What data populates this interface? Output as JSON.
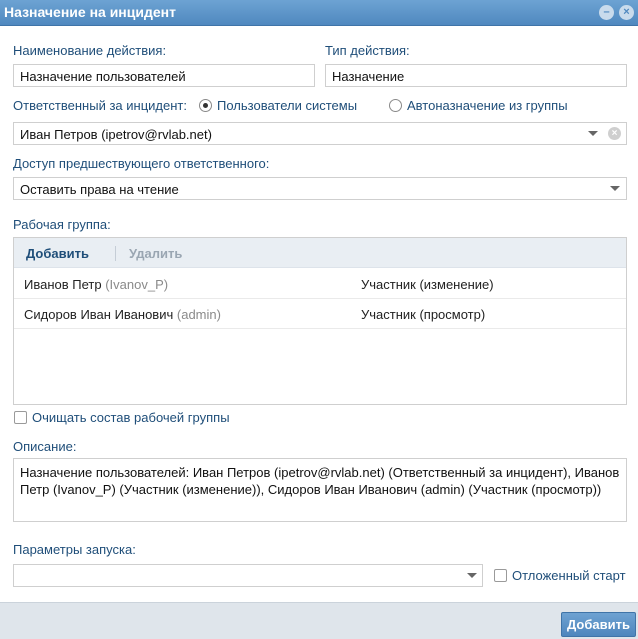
{
  "window": {
    "title": "Назначение на инцидент",
    "minimize_icon": "minimize-icon",
    "close_icon": "close-icon"
  },
  "form": {
    "action_name_label": "Наименование действия:",
    "action_name_value": "Назначение пользователей",
    "action_type_label": "Тип действия:",
    "action_type_value": "Назначение",
    "responsible_label": "Ответственный за инцидент:",
    "radio_system_users": "Пользователи системы",
    "radio_auto_assign": "Автоназначение из группы",
    "responsible_value": "Иван Петров (ipetrov@rvlab.net)",
    "prev_access_label": "Доступ предшествующего ответственного:",
    "prev_access_value": "Оставить права на чтение",
    "workgroup_label": "Рабочая группа:",
    "clear_workgroup_label": "Очищать состав рабочей группы",
    "description_label": "Описание:",
    "description_value": "Назначение пользователей: Иван Петров (ipetrov@rvlab.net) (Ответственный за инцидент), Иванов Петр (Ivanov_P) (Участник (изменение)), Сидоров Иван Иванович (admin) (Участник (просмотр))",
    "launch_params_label": "Параметры запуска:",
    "launch_params_value": "",
    "deferred_start_label": "Отложенный старт"
  },
  "workgroup": {
    "add_label": "Добавить",
    "delete_label": "Удалить",
    "rows": [
      {
        "name": "Иванов Петр",
        "login": "(Ivanov_P)",
        "role": "Участник (изменение)"
      },
      {
        "name": "Сидоров Иван Иванович",
        "login": "(admin)",
        "role": "Участник (просмотр)"
      }
    ]
  },
  "footer": {
    "submit_label": "Добавить"
  }
}
